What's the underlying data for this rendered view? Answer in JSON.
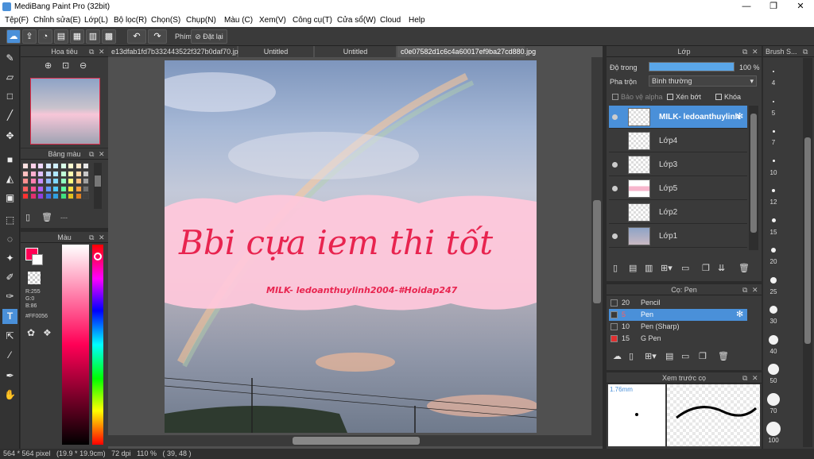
{
  "app": {
    "title": "MediBang Paint Pro (32bit)",
    "win_min": "—",
    "win_max": "❐",
    "win_close": "✕"
  },
  "menu": [
    "Tệp(F)",
    "Chỉnh sửa(E)",
    "Lớp(L)",
    "Bộ lọc(R)",
    "Chọn(S)",
    "Chụp(N)",
    "Màu (C)",
    "Xem(V)",
    "Công cụ(T)",
    "Cửa sổ(W)",
    "Cloud",
    "Help"
  ],
  "toolbar": {
    "snap_label": "Phím",
    "reset_label": "Đặt lại"
  },
  "tabs": [
    "e13dfab1fd7b332443522f327b0daf70.jpg",
    "Untitled",
    "Untitled",
    "c0e07582d1c6c4a60017ef9ba27cd880.jpg"
  ],
  "navigator": {
    "title": "Hoa tiêu"
  },
  "palette": {
    "title": "Bảng màu",
    "footer": "---"
  },
  "color": {
    "title": "Màu",
    "r": "R:255",
    "g": "G:0",
    "b": "B:86",
    "hex": "#FF0056",
    "primary": "#ff0056"
  },
  "canvas": {
    "big_text": "Bbi cựa iem thi tốt",
    "small_text": "MILK- ledoanthuylinh2004-#Hoidap247"
  },
  "layers": {
    "title": "Lớp",
    "opacity_label": "Độ trong",
    "opacity_value": "100 %",
    "opacity": 1.0,
    "blend_label": "Pha trộn",
    "blend_value": "Bình thường",
    "protect_alpha": "Bảo vệ alpha",
    "clipping": "Xén bớt",
    "lock": "Khóa",
    "items": [
      {
        "name": "MILK- ledoanthuylinh"
      },
      {
        "name": "Lớp4"
      },
      {
        "name": "Lớp3"
      },
      {
        "name": "Lớp5"
      },
      {
        "name": "Lớp2"
      },
      {
        "name": "Lớp1"
      }
    ]
  },
  "brush": {
    "title": "Cọ: Pen",
    "items": [
      {
        "size": "20",
        "name": "Pencil",
        "color": "#3a3a3a"
      },
      {
        "size": "5",
        "name": "Pen",
        "color": "#3a3a3a"
      },
      {
        "size": "10",
        "name": "Pen (Sharp)",
        "color": "#3a3a3a"
      },
      {
        "size": "15",
        "name": "G Pen",
        "color": "#e03030"
      }
    ]
  },
  "preview": {
    "title": "Xem trước cọ",
    "size": "1.76mm"
  },
  "brush_size": {
    "title": "Brush S...",
    "values": [
      "4",
      "5",
      "7",
      "10",
      "12",
      "15",
      "20",
      "25",
      "30",
      "40",
      "50",
      "70",
      "100"
    ]
  },
  "status": {
    "text": "564 * 564 pixel   (19.9 * 19.9cm)   72 dpi   110 %   ( 39, 48 )"
  }
}
